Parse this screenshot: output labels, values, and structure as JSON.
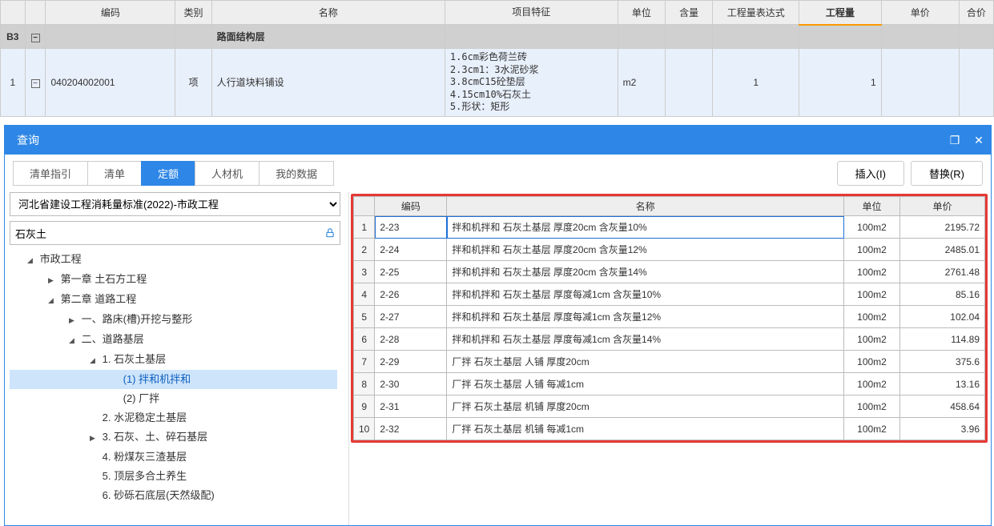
{
  "top_header": {
    "code": "编码",
    "kind": "类别",
    "name": "名称",
    "feature": "项目特征",
    "unit": "单位",
    "content": "含量",
    "qty_expr": "工程量表达式",
    "qty": "工程量",
    "price": "单价",
    "total": "合价"
  },
  "group_row": {
    "rownum": "B3",
    "name": "路面结构层"
  },
  "item_row": {
    "rownum": "1",
    "code": "040204002001",
    "kind": "项",
    "name": "人行道块料铺设",
    "feature": "1.6cm彩色荷兰砖\n2.3cm1：3水泥砂浆\n3.8cmC15砼垫层\n4.15cm10%石灰土\n5.形状：矩形",
    "unit": "m2",
    "qty_expr": "1",
    "qty": "1"
  },
  "query_panel": {
    "title": "查询",
    "tabs": [
      "清单指引",
      "清单",
      "定额",
      "人材机",
      "我的数据"
    ],
    "active_tab_index": 2,
    "insert_btn": "插入(I)",
    "replace_btn": "替换(R)",
    "standard_select": "河北省建设工程消耗量标准(2022)-市政工程",
    "search_value": "石灰土"
  },
  "tree": [
    {
      "level": 1,
      "open": true,
      "label": "市政工程"
    },
    {
      "level": 2,
      "open": false,
      "label": "第一章 土石方工程"
    },
    {
      "level": 2,
      "open": true,
      "label": "第二章 道路工程"
    },
    {
      "level": 3,
      "open": false,
      "label": "一、路床(槽)开挖与整形"
    },
    {
      "level": 3,
      "open": true,
      "label": "二、道路基层"
    },
    {
      "level": 4,
      "open": true,
      "label": "1. 石灰土基层"
    },
    {
      "level": 5,
      "open": null,
      "label": "(1) 拌和机拌和",
      "selected": true
    },
    {
      "level": 5,
      "open": null,
      "label": "(2) 厂拌"
    },
    {
      "level": 4,
      "open": null,
      "label": "2. 水泥稳定土基层"
    },
    {
      "level": 4,
      "open": false,
      "label": "3. 石灰、土、碎石基层"
    },
    {
      "level": 4,
      "open": null,
      "label": "4. 粉煤灰三渣基层"
    },
    {
      "level": 4,
      "open": null,
      "label": "5. 顶层多合土养生"
    },
    {
      "level": 4,
      "open": null,
      "label": "6. 砂砾石底层(天然级配)"
    }
  ],
  "result_header": {
    "code": "编码",
    "name": "名称",
    "unit": "单位",
    "price": "单价"
  },
  "results": [
    {
      "idx": "1",
      "code": "2-23",
      "name": "拌和机拌和 石灰土基层 厚度20cm 含灰量10%",
      "unit": "100m2",
      "price": "2195.72"
    },
    {
      "idx": "2",
      "code": "2-24",
      "name": "拌和机拌和 石灰土基层 厚度20cm 含灰量12%",
      "unit": "100m2",
      "price": "2485.01"
    },
    {
      "idx": "3",
      "code": "2-25",
      "name": "拌和机拌和 石灰土基层 厚度20cm 含灰量14%",
      "unit": "100m2",
      "price": "2761.48"
    },
    {
      "idx": "4",
      "code": "2-26",
      "name": "拌和机拌和 石灰土基层 厚度每减1cm 含灰量10%",
      "unit": "100m2",
      "price": "85.16"
    },
    {
      "idx": "5",
      "code": "2-27",
      "name": "拌和机拌和 石灰土基层 厚度每减1cm 含灰量12%",
      "unit": "100m2",
      "price": "102.04"
    },
    {
      "idx": "6",
      "code": "2-28",
      "name": "拌和机拌和 石灰土基层 厚度每减1cm 含灰量14%",
      "unit": "100m2",
      "price": "114.89"
    },
    {
      "idx": "7",
      "code": "2-29",
      "name": "厂拌 石灰土基层 人铺 厚度20cm",
      "unit": "100m2",
      "price": "375.6"
    },
    {
      "idx": "8",
      "code": "2-30",
      "name": "厂拌 石灰土基层 人铺 每减1cm",
      "unit": "100m2",
      "price": "13.16"
    },
    {
      "idx": "9",
      "code": "2-31",
      "name": "厂拌 石灰土基层 机铺 厚度20cm",
      "unit": "100m2",
      "price": "458.64"
    },
    {
      "idx": "10",
      "code": "2-32",
      "name": "厂拌 石灰土基层 机铺 每减1cm",
      "unit": "100m2",
      "price": "3.96"
    }
  ]
}
